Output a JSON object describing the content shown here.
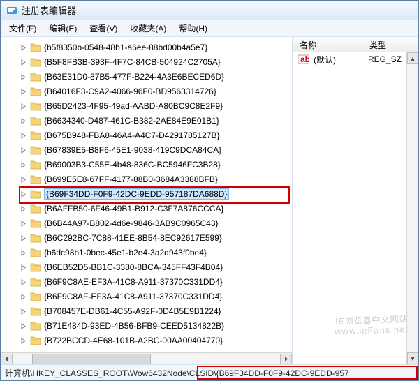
{
  "window": {
    "title": "注册表编辑器"
  },
  "menu": {
    "file": "文件(F)",
    "edit": "编辑(E)",
    "view": "查看(V)",
    "fav": "收藏夹(A)",
    "help": "帮助(H)"
  },
  "tree": {
    "items": [
      "{b5f8350b-0548-48b1-a6ee-88bd00b4a5e7}",
      "{B5F8FB3B-393F-4F7C-84CB-504924C2705A}",
      "{B63E31D0-87B5-477F-B224-4A3E6BECED6D}",
      "{B64016F3-C9A2-4066-96F0-BD9563314726}",
      "{B65D2423-4F95-49ad-AABD-A80BC9C8E2F9}",
      "{B6634340-D487-461C-B382-2AE84E9E01B1}",
      "{B675B948-FBA8-46A4-A4C7-D4291785127B}",
      "{B67839E5-B8F6-45E1-9038-419C9DCA84CA}",
      "{B69003B3-C55E-4b48-836C-BC5946FC3B28}",
      "{B699E5E8-67FF-4177-88B0-3684A3388BFB}",
      "{B69F34DD-F0F9-42DC-9EDD-957187DA688D}",
      "{B6AFFB50-6F46-49B1-B912-C3F7A876CCCA}",
      "{B6B44A97-B802-4d6e-9846-3AB9C0965C43}",
      "{B6C292BC-7C88-41EE-8B54-8EC92617E599}",
      "{b6dc98b1-0bec-45e1-b2e4-3a2d943f0be4}",
      "{B6EB52D5-BB1C-3380-8BCA-345FF43F4B04}",
      "{B6F9C8AE-EF3A-41C8-A911-37370C331DD4}",
      "{B6F9C8AF-EF3A-41C8-A911-37370C331DD4}",
      "{B708457E-DB61-4C55-A92F-0D4B5E9B1224}",
      "{B71E484D-93ED-4B56-BFB9-CEED5134822B}",
      "{B722BCCD-4E68-101B-A2BC-00AA00404770}"
    ],
    "selected_index": 10
  },
  "list": {
    "header_name": "名称",
    "header_type": "类型",
    "default_label": "(默认)",
    "default_type": "REG_SZ"
  },
  "statusbar": {
    "path": "计算机\\HKEY_CLASSES_ROOT\\Wow6432Node\\CLSID\\{B69F34DD-F0F9-42DC-9EDD-957"
  },
  "watermark": {
    "line1": "IE浏览器中文网站",
    "line2": "www.ieFans.net"
  },
  "colors": {
    "highlight_border": "#d40000",
    "selection_bg": "#cde8ff"
  }
}
